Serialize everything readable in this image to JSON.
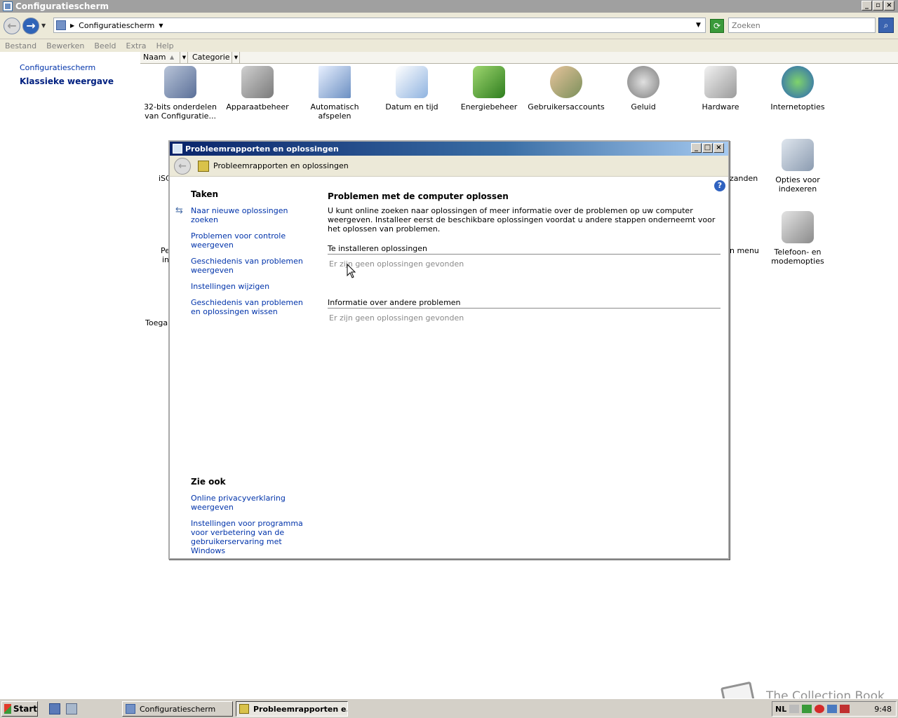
{
  "main_window": {
    "title": "Configuratiescherm",
    "address": "Configuratiescherm",
    "search_placeholder": "Zoeken",
    "menu": [
      "Bestand",
      "Bewerken",
      "Beeld",
      "Extra",
      "Help"
    ],
    "columns": {
      "naam": "Naam",
      "categorie": "Categorie"
    },
    "left_links": {
      "home": "Configuratiescherm",
      "classic": "Klassieke weergave"
    },
    "items_row1": [
      {
        "label": "32-bits onderdelen van Configuratie...",
        "icon": "components-icon"
      },
      {
        "label": "Apparaatbeheer",
        "icon": "device-manager-icon"
      },
      {
        "label": "Automatisch afspelen",
        "icon": "autoplay-icon"
      },
      {
        "label": "Datum en tijd",
        "icon": "date-time-icon"
      },
      {
        "label": "Energiebeheer",
        "icon": "power-icon"
      },
      {
        "label": "Gebruikersaccounts",
        "icon": "user-accounts-icon"
      },
      {
        "label": "Geluid",
        "icon": "sound-icon"
      },
      {
        "label": "Hardware",
        "icon": "hardware-icon"
      },
      {
        "label": "Internetopties",
        "icon": "internet-options-icon"
      }
    ],
    "partial_items": {
      "iscsi": "iSC",
      "pe": "Pe",
      "in": "in",
      "toegan": "Toegan",
      "zanden": "zanden",
      "menu": "n menu"
    },
    "items_right": [
      {
        "label": "Opties voor indexeren",
        "icon": "indexing-icon"
      },
      {
        "label": "Telefoon- en modemopties",
        "icon": "phone-modem-icon"
      }
    ]
  },
  "dialog": {
    "title": "Probleemrapporten en oplossingen",
    "breadcrumb": "Probleemrapporten en oplossingen",
    "tasks_heading": "Taken",
    "tasks": [
      "Naar nieuwe oplossingen zoeken",
      "Problemen voor controle weergeven",
      "Geschiedenis van problemen weergeven",
      "Instellingen wijzigen",
      "Geschiedenis van problemen en oplossingen wissen"
    ],
    "see_also_heading": "Zie ook",
    "see_also": [
      "Online privacyverklaring weergeven",
      "Instellingen voor programma voor verbetering van de gebruikerservaring met Windows"
    ],
    "content_heading": "Problemen met de computer oplossen",
    "content_intro": "U kunt online zoeken naar oplossingen of meer informatie over de problemen op uw computer weergeven. Installeer eerst de beschikbare oplossingen voordat u andere stappen onderneemt voor het oplossen van problemen.",
    "section1_heading": "Te installeren oplossingen",
    "section1_empty": "Er zijn geen oplossingen gevonden",
    "section2_heading": "Informatie over andere problemen",
    "section2_empty": "Er zijn geen oplossingen gevonden"
  },
  "taskbar": {
    "start": "Start",
    "buttons": [
      "Configuratiescherm",
      "Probleemrapporten e..."
    ],
    "language": "NL",
    "clock": "9:48"
  },
  "watermark": "The Collection Book",
  "colors": {
    "link": "#0033aa",
    "title_gradient_start": "#0a246a",
    "window_chrome": "#ece9d8"
  }
}
